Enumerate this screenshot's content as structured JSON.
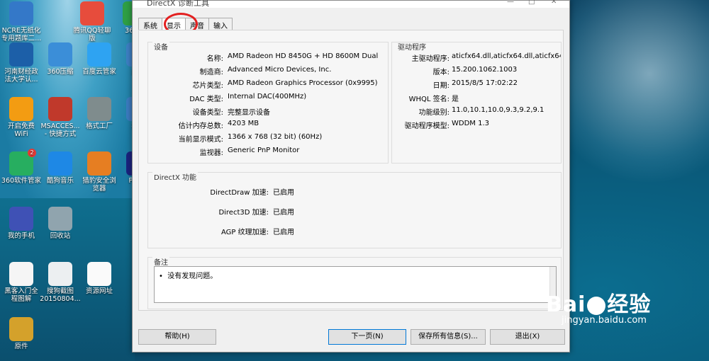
{
  "desktop": {
    "icons": [
      {
        "label": "NCRE无纸化\n专用题库二...",
        "color": "#3478c8"
      },
      {
        "label": "腾讯QQ轻聊\n版",
        "color": "#e74c3c"
      },
      {
        "label": "360安",
        "color": "#2e9e44"
      },
      {
        "label": "河南财经政\n法大学认...",
        "color": "#1c5fa8"
      },
      {
        "label": "360压缩",
        "color": "#3b8ed8"
      },
      {
        "label": "百度云管家",
        "color": "#2ea3f2"
      },
      {
        "label": "此电",
        "color": "#3d7fc3"
      },
      {
        "label": "开启免费\nWiFi",
        "color": "#f39c12"
      },
      {
        "label": "MSACCES...\n- 快捷方式",
        "color": "#c0392b"
      },
      {
        "label": "格式工厂",
        "color": "#7f8c8d"
      },
      {
        "label": "控制",
        "color": "#3b7bbf"
      },
      {
        "label": "360软件管家",
        "color": "#27ae60"
      },
      {
        "label": "酷狗音乐",
        "color": "#1e88e5"
      },
      {
        "label": "猎豹安全浏\n览器",
        "color": "#e67e22"
      },
      {
        "label": "Photo",
        "color": "#1a237e"
      },
      {
        "label": "我的手机",
        "color": "#3f51b5"
      },
      {
        "label": "回收站",
        "color": "#90a4ae"
      },
      {
        "label": "黑客入门全\n程图解",
        "color": "#f5f5f5"
      },
      {
        "label": "搜狗截图\n20150804...",
        "color": "#eceff1"
      },
      {
        "label": "资源网址",
        "color": "#fafafa"
      },
      {
        "label": "原件",
        "color": "#d4a12b"
      }
    ],
    "badge": "2"
  },
  "window": {
    "title": "DirectX 诊断工具",
    "controls": [
      "—",
      "□",
      "✕"
    ]
  },
  "tabs": [
    {
      "label": "系统"
    },
    {
      "label": "显示"
    },
    {
      "label": "声音"
    },
    {
      "label": "输入"
    }
  ],
  "device": {
    "title": "设备",
    "rows": [
      {
        "key": "名称:",
        "value": "AMD Radeon HD 8450G + HD 8600M Dual"
      },
      {
        "key": "制造商:",
        "value": "Advanced Micro Devices, Inc."
      },
      {
        "key": "芯片类型:",
        "value": "AMD Radeon Graphics Processor (0x9995)"
      },
      {
        "key": "DAC 类型:",
        "value": "Internal DAC(400MHz)"
      },
      {
        "key": "设备类型:",
        "value": "完整显示设备"
      },
      {
        "key": "估计内存总数:",
        "value": "4203 MB"
      },
      {
        "key": "当前显示模式:",
        "value": "1366 x 768 (32 bit) (60Hz)"
      },
      {
        "key": "监视器:",
        "value": "Generic PnP Monitor"
      }
    ]
  },
  "driver": {
    "title": "驱动程序",
    "rows": [
      {
        "key": "主驱动程序:",
        "value": "aticfx64.dll,aticfx64.dll,aticfx64.dll,am"
      },
      {
        "key": "版本:",
        "value": "15.200.1062.1003"
      },
      {
        "key": "日期:",
        "value": "2015/8/5 17:02:22"
      },
      {
        "key": "WHQL 签名:",
        "value": "是"
      },
      {
        "key": "功能级别:",
        "value": "11.0,10.1,10.0,9.3,9.2,9.1"
      },
      {
        "key": "驱动程序模型:",
        "value": "WDDM 1.3"
      }
    ]
  },
  "features": {
    "title": "DirectX 功能",
    "rows": [
      {
        "key": "DirectDraw 加速:",
        "value": "已启用"
      },
      {
        "key": "Direct3D 加速:",
        "value": "已启用"
      },
      {
        "key": "AGP 纹理加速:",
        "value": "已启用"
      }
    ]
  },
  "notes": {
    "title": "备注",
    "items": [
      "没有发现问题。"
    ]
  },
  "buttons": {
    "help": "帮助(H)",
    "next": "下一页(N)",
    "save": "保存所有信息(S)...",
    "exit": "退出(X)"
  },
  "watermark": {
    "logo_left": "Bai",
    "logo_right": "经验",
    "url": "jingyan.baidu.com"
  }
}
